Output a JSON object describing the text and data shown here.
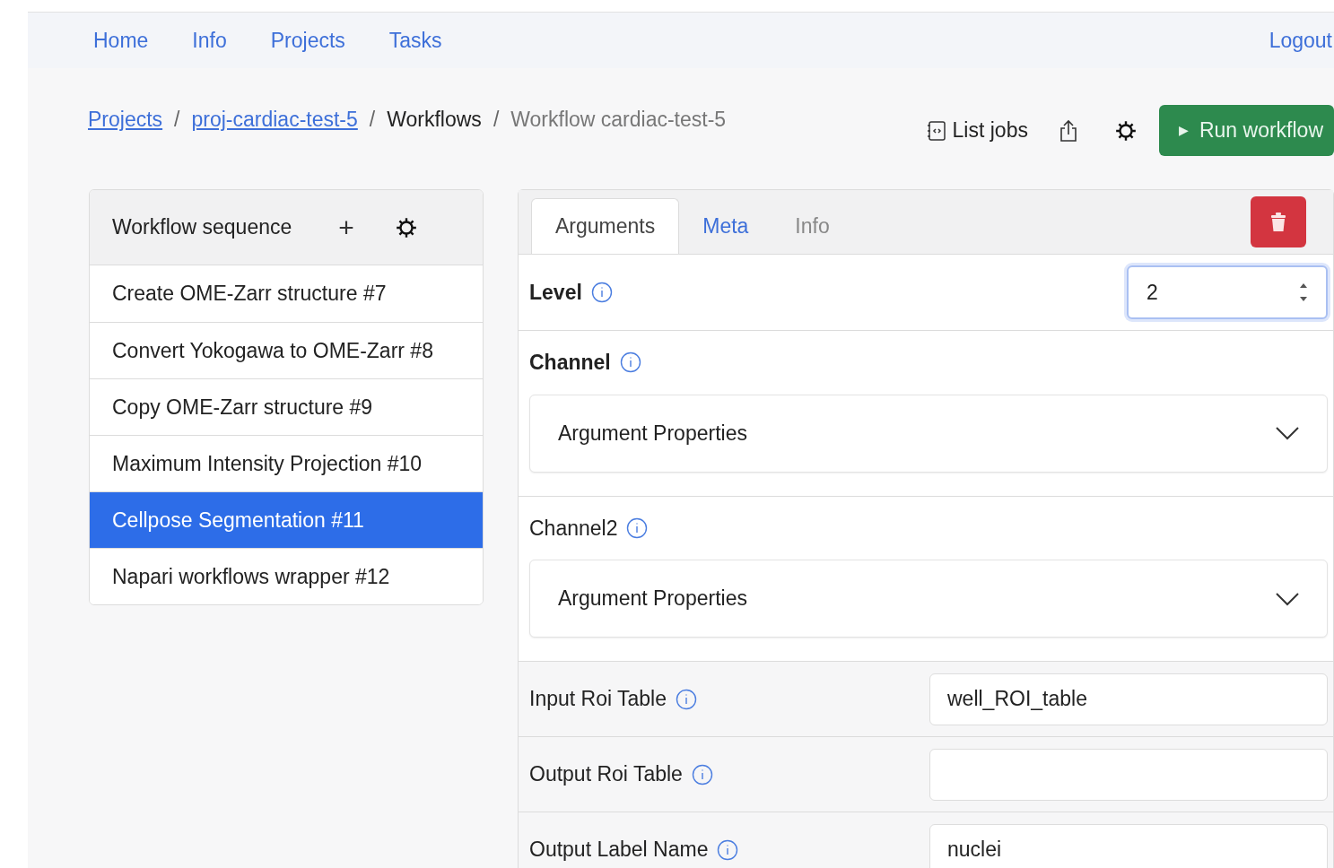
{
  "nav": {
    "links": [
      {
        "label": "Home"
      },
      {
        "label": "Info"
      },
      {
        "label": "Projects"
      },
      {
        "label": "Tasks"
      }
    ],
    "logout": "Logout"
  },
  "breadcrumb": [
    {
      "kind": "link",
      "label": "Projects"
    },
    {
      "kind": "separator",
      "label": "/"
    },
    {
      "kind": "link",
      "label": "proj-cardiac-test-5"
    },
    {
      "kind": "separator",
      "label": "/"
    },
    {
      "kind": "text",
      "label": "Workflows"
    },
    {
      "kind": "separator",
      "label": "/"
    },
    {
      "kind": "current",
      "label": "Workflow cardiac-test-5"
    }
  ],
  "toolbar": {
    "list_jobs": "List jobs",
    "run": "Run workflow",
    "run_icon": "▶"
  },
  "sequence": {
    "title": "Workflow sequence",
    "add": "+",
    "items": [
      {
        "label": "Create OME-Zarr structure #7",
        "selected": false
      },
      {
        "label": "Convert Yokogawa to OME-Zarr #8",
        "selected": false
      },
      {
        "label": "Copy OME-Zarr structure #9",
        "selected": false
      },
      {
        "label": "Maximum Intensity Projection #10",
        "selected": false
      },
      {
        "label": "Cellpose Segmentation #11",
        "selected": true
      },
      {
        "label": "Napari workflows wrapper #12",
        "selected": false
      }
    ]
  },
  "tabs": [
    {
      "label": "Arguments",
      "selected": true,
      "disabled": false
    },
    {
      "label": "Meta",
      "selected": false,
      "disabled": false
    },
    {
      "label": "Info",
      "selected": false,
      "disabled": true
    }
  ],
  "arguments": [
    {
      "kind": "number",
      "label": "Level",
      "required": true,
      "value": "2",
      "focused": true
    },
    {
      "kind": "object",
      "label": "Channel",
      "required": true,
      "summary": "Argument Properties",
      "expanded": false
    },
    {
      "kind": "object",
      "label": "Channel2",
      "required": false,
      "summary": "Argument Properties",
      "expanded": false
    },
    {
      "kind": "text",
      "label": "Input Roi Table",
      "required": false,
      "value": "well_ROI_table"
    },
    {
      "kind": "text",
      "label": "Output Roi Table",
      "required": false
    },
    {
      "kind": "text",
      "label": "Output Label Name",
      "required": false,
      "value": "nuclei"
    }
  ]
}
